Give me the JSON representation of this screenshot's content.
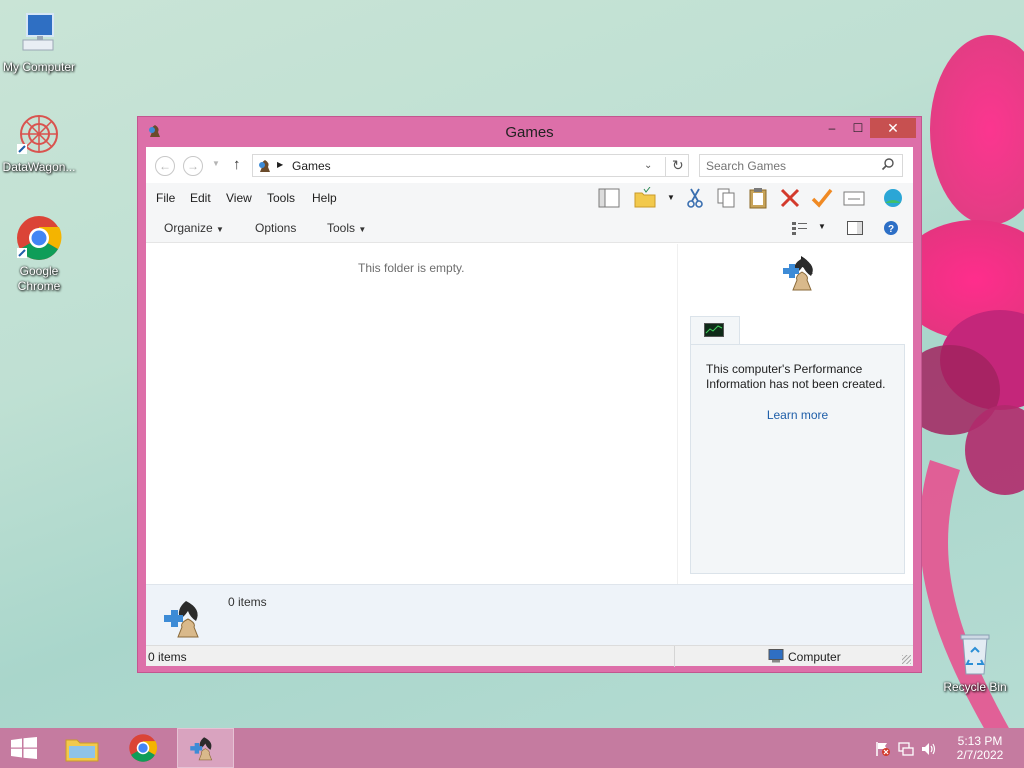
{
  "desktop": {
    "icons": [
      {
        "label": "My Computer"
      },
      {
        "label": "DataWagon..."
      },
      {
        "label": "Google Chrome"
      },
      {
        "label": "Recycle Bin"
      }
    ]
  },
  "window": {
    "title": "Games",
    "controls": {
      "minimize": "‒",
      "maximize": "☐",
      "close": "✕"
    },
    "nav": {
      "back": "←",
      "forward": "→",
      "up": "↑"
    },
    "address": {
      "path": "Games"
    },
    "search": {
      "placeholder": "Search Games"
    },
    "menu": [
      "File",
      "Edit",
      "View",
      "Tools",
      "Help"
    ],
    "commands": {
      "organize": "Organize",
      "options": "Options",
      "tools": "Tools"
    },
    "content": {
      "empty_text": "This folder is empty."
    },
    "performance": {
      "message": "This computer's Performance Information has not been created.",
      "link": "Learn more"
    },
    "details": {
      "count": "0 items"
    },
    "status": {
      "left": "0 items",
      "right": "Computer"
    }
  },
  "taskbar": {
    "time": "5:13 PM",
    "date": "2/7/2022"
  },
  "colors": {
    "window_frame": "#dd6fa9",
    "taskbar": "#c57ba0",
    "close_button": "#c75050",
    "link": "#1e5ea8"
  }
}
